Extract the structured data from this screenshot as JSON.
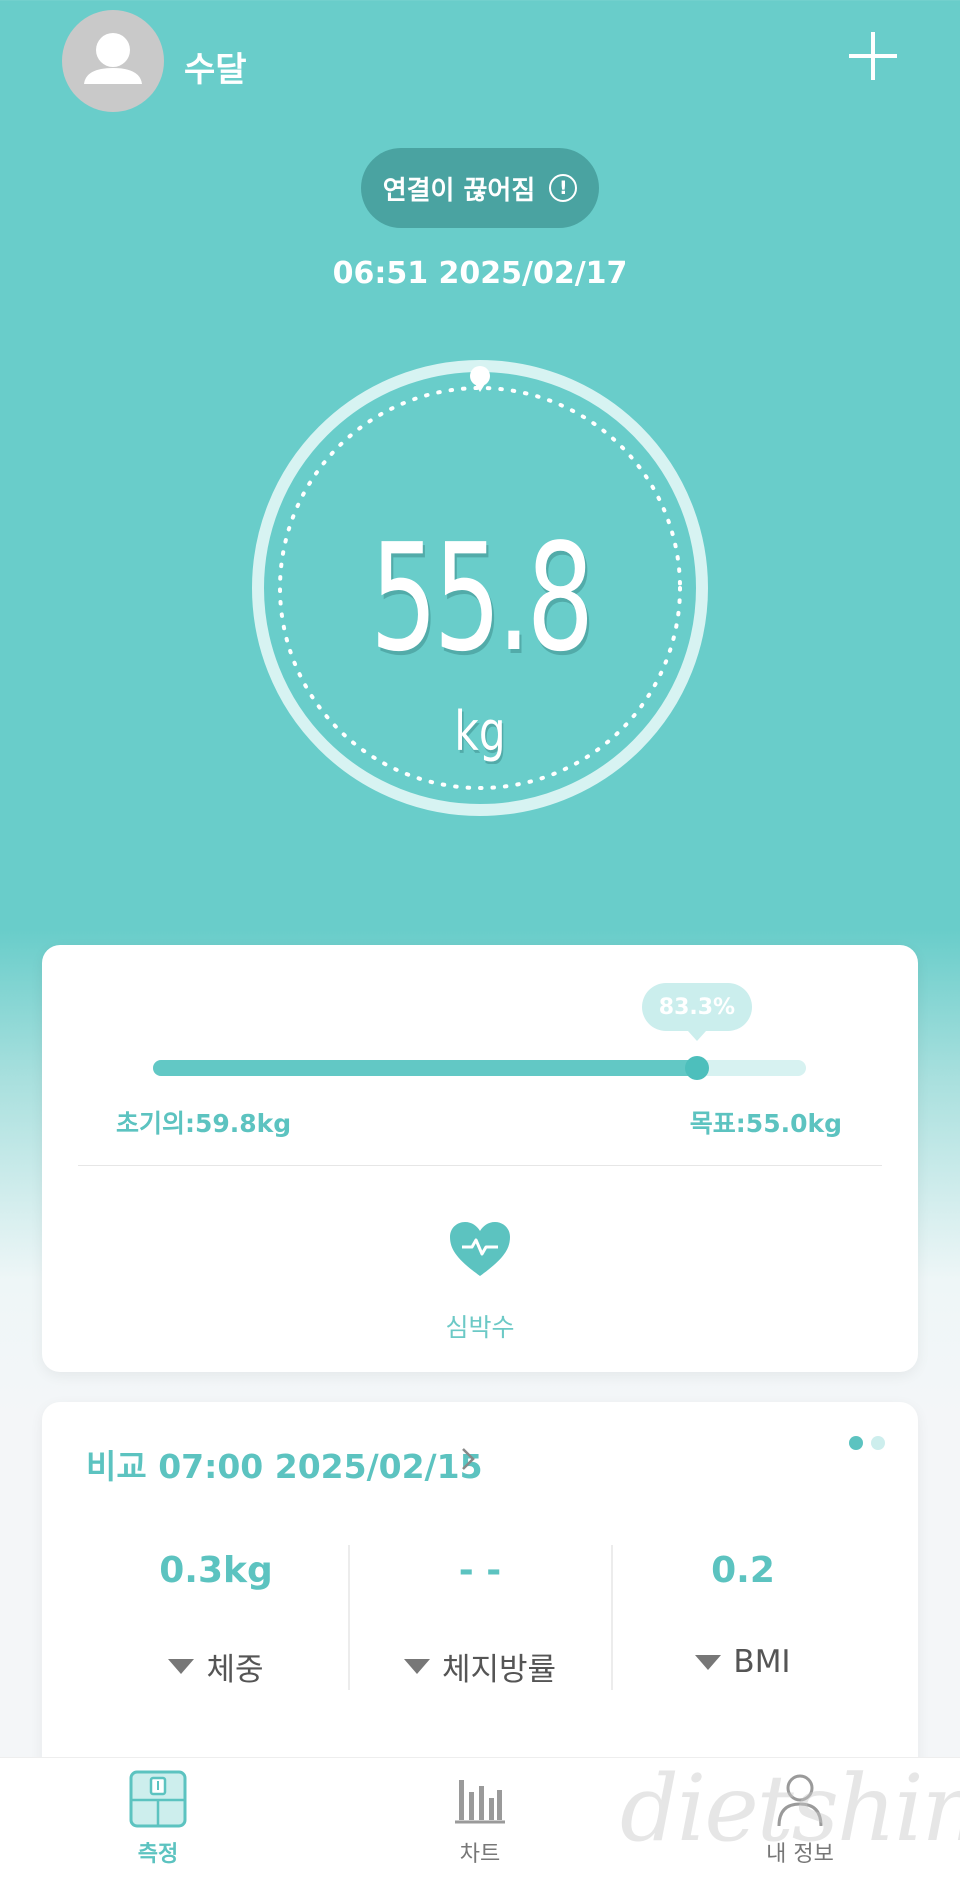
{
  "header": {
    "username": "수달",
    "connection_status": "연결이 끊어짐",
    "alert_symbol": "!",
    "datetime": "06:51 2025/02/17"
  },
  "measurement": {
    "weight": "55.8",
    "unit": "kg"
  },
  "goal": {
    "progress_label": "83.3%",
    "progress_fraction": 0.833,
    "initial_label": "초기의:59.8kg",
    "target_label": "목표:55.0kg"
  },
  "heart_rate": {
    "label": "심박수"
  },
  "compare": {
    "title": "비교 07:00 2025/02/15",
    "stats": [
      {
        "value": "0.3kg",
        "label": "체중"
      },
      {
        "value": "- -",
        "label": "체지방률"
      },
      {
        "value": "0.2",
        "label": "BMI"
      }
    ]
  },
  "nav": {
    "items": [
      {
        "label": "측정",
        "icon": "scale-icon",
        "active": true
      },
      {
        "label": "차트",
        "icon": "bar-chart-icon",
        "active": false
      },
      {
        "label": "내 정보",
        "icon": "profile-icon",
        "active": false
      }
    ]
  },
  "watermark": "dietshin.com",
  "colors": {
    "accent": "#5cc3c0",
    "header_bg": "#69cdca",
    "pill_bg": "#4aa3a1"
  }
}
